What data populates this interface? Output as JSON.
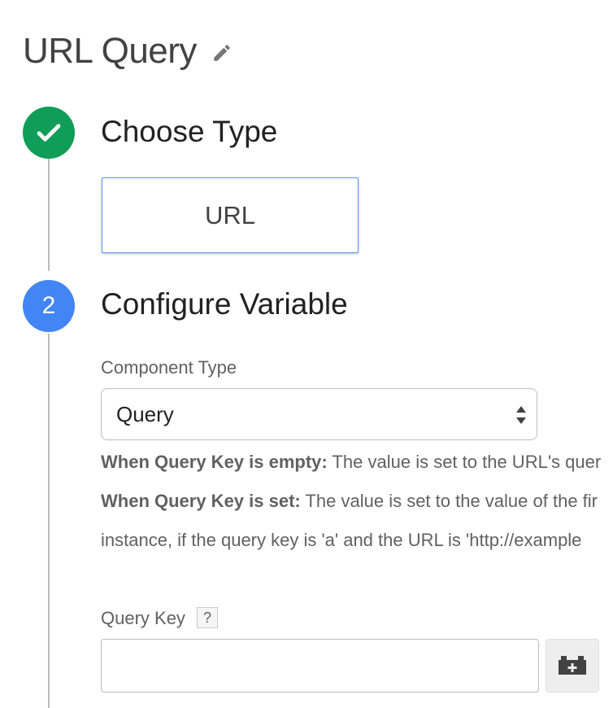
{
  "header": {
    "title": "URL Query",
    "edit_icon": "pencil-icon"
  },
  "colors": {
    "step_done": "#0f9d58",
    "step_active": "#4285f4",
    "card_border": "#5e97f6"
  },
  "steps": [
    {
      "title": "Choose Type",
      "status": "done",
      "icon": "check-icon",
      "selected_type": "URL"
    },
    {
      "number": "2",
      "title": "Configure Variable",
      "status": "active"
    }
  ],
  "component_type": {
    "label": "Component Type",
    "selected": "Query"
  },
  "help": {
    "line1_bold": "When Query Key is empty:",
    "line1_text": " The value is set to the URL's quer",
    "line2_bold": "When Query Key is set:",
    "line2_text": " The value is set to the value of the fir",
    "line3_text": "instance, if the query key is 'a' and the URL is 'http://example"
  },
  "query_key": {
    "label": "Query Key",
    "help_badge": "?",
    "value": "",
    "placeholder": "",
    "variable_button_icon": "lego-plus-icon"
  }
}
